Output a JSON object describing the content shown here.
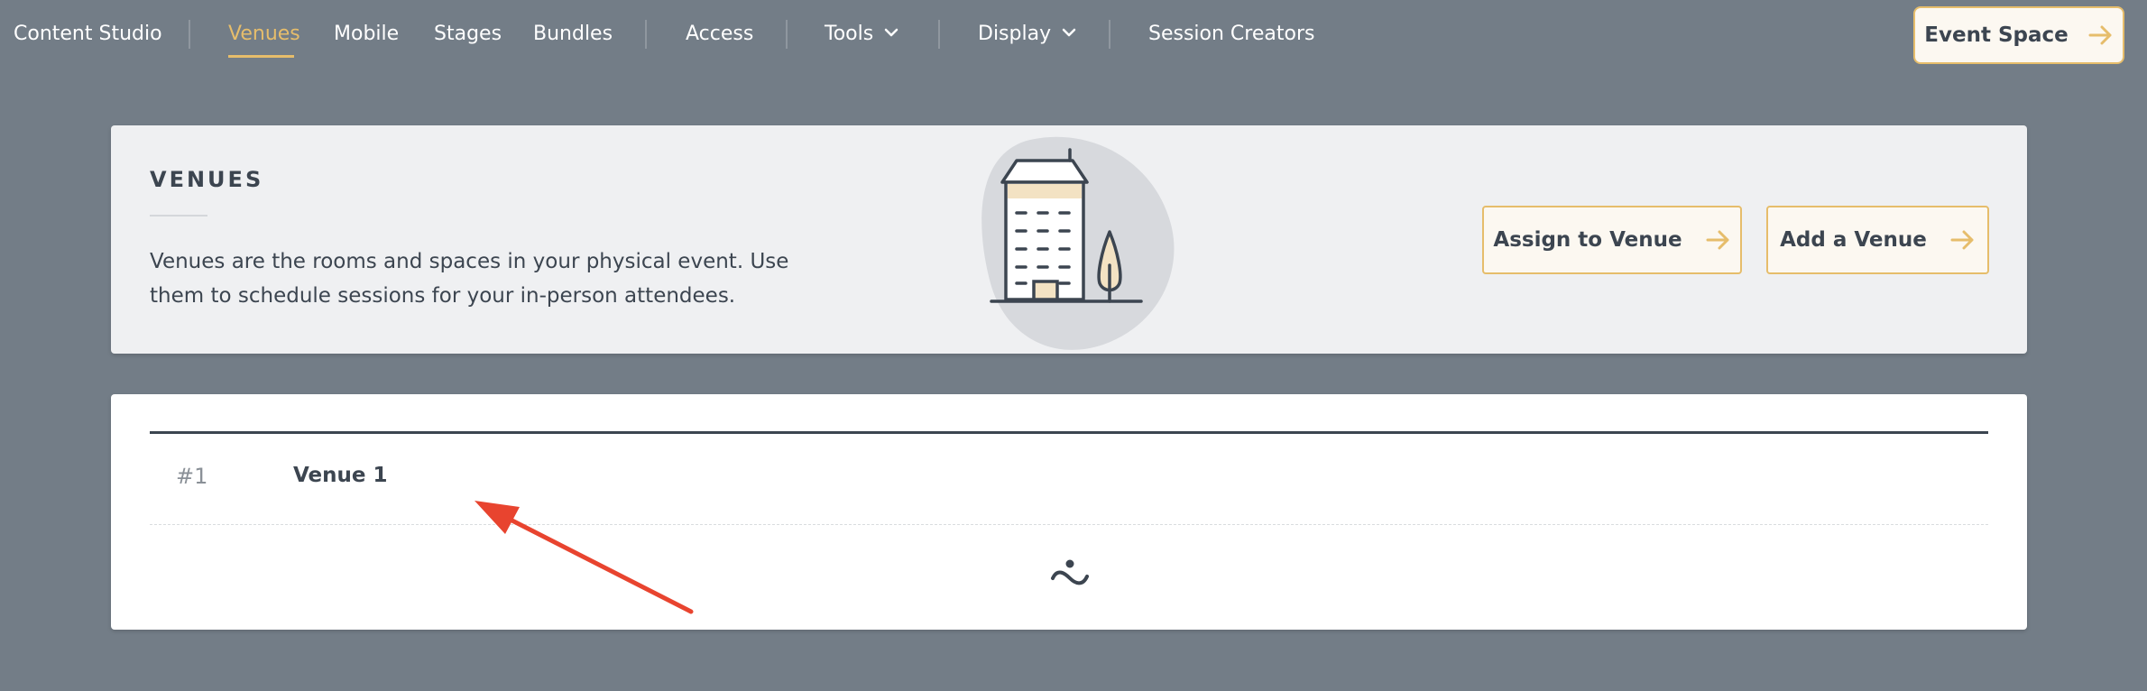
{
  "nav": {
    "items": [
      {
        "label": "Content Studio"
      },
      {
        "label": "Venues",
        "active": true
      },
      {
        "label": "Mobile"
      },
      {
        "label": "Stages"
      },
      {
        "label": "Bundles"
      },
      {
        "label": "Access"
      },
      {
        "label": "Tools",
        "has_dropdown": true
      },
      {
        "label": "Display",
        "has_dropdown": true
      },
      {
        "label": "Session Creators"
      }
    ],
    "event_space_button": {
      "label": "Event Space",
      "icon": "arrow-right-icon"
    }
  },
  "header": {
    "title": "VENUES",
    "description": "Venues are the rooms and spaces in your physical event. Use them to schedule sessions for your in-person attendees.",
    "illustration": "building-illustration",
    "buttons": {
      "assign": {
        "label": "Assign to Venue",
        "icon": "arrow-right-icon"
      },
      "add": {
        "label": "Add a Venue",
        "icon": "arrow-right-icon"
      }
    }
  },
  "venues": [
    {
      "number": "#1",
      "name": "Venue 1"
    }
  ],
  "list_footer_icon": "drag-handle-icon",
  "annotation": {
    "icon": "red-arrow-annotation",
    "color": "#e8442f"
  },
  "colors": {
    "background": "#737d87",
    "accent": "#e6bd6b",
    "text_dark": "#3c4550",
    "card_light": "#eff0f2",
    "button_bg": "#fcf8f1"
  }
}
